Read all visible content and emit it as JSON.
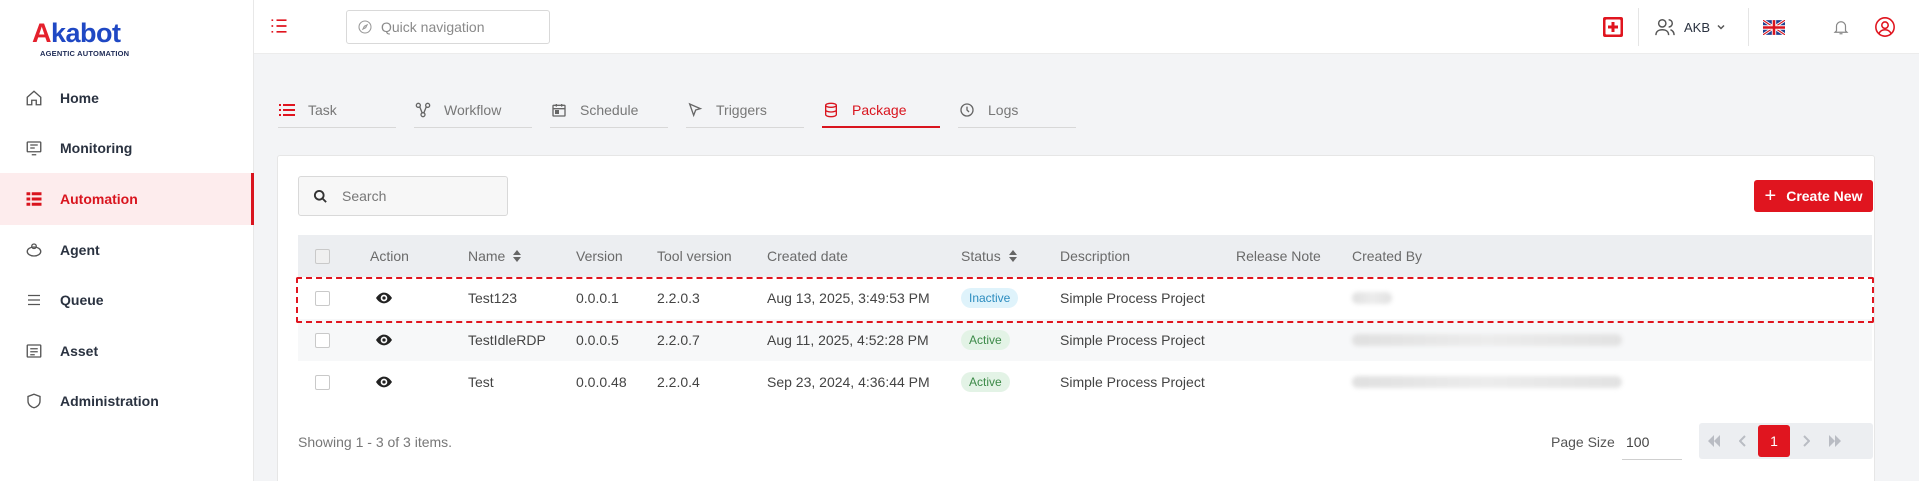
{
  "brand": {
    "name_part1": "A",
    "name_part2": "kabot",
    "tagline": "AGENTIC AUTOMATION"
  },
  "sidebar": {
    "items": [
      {
        "label": "Home",
        "icon": "home-icon"
      },
      {
        "label": "Monitoring",
        "icon": "monitor-icon"
      },
      {
        "label": "Automation",
        "icon": "automation-icon",
        "active": true
      },
      {
        "label": "Agent",
        "icon": "agent-icon"
      },
      {
        "label": "Queue",
        "icon": "queue-icon"
      },
      {
        "label": "Asset",
        "icon": "asset-icon"
      },
      {
        "label": "Administration",
        "icon": "shield-icon"
      }
    ]
  },
  "topbar": {
    "quick_nav_placeholder": "Quick navigation",
    "user_label": "AKB"
  },
  "tabs": [
    {
      "label": "Task",
      "icon": "list-icon"
    },
    {
      "label": "Workflow",
      "icon": "workflow-icon"
    },
    {
      "label": "Schedule",
      "icon": "calendar-icon"
    },
    {
      "label": "Triggers",
      "icon": "cursor-icon"
    },
    {
      "label": "Package",
      "icon": "database-icon",
      "active": true
    },
    {
      "label": "Logs",
      "icon": "clock-icon"
    }
  ],
  "search": {
    "placeholder": "Search"
  },
  "create_button": {
    "label": "Create New"
  },
  "table": {
    "columns": [
      "Action",
      "Name",
      "Version",
      "Tool version",
      "Created date",
      "Status",
      "Description",
      "Release Note",
      "Created By"
    ],
    "rows": [
      {
        "name": "Test123",
        "version": "0.0.0.1",
        "tool_version": "2.2.0.3",
        "created_date": "Aug 13, 2025, 3:49:53 PM",
        "status": "Inactive",
        "description": "Simple Process Project",
        "release_note": "",
        "created_by": ""
      },
      {
        "name": "TestIdleRDP",
        "version": "0.0.0.5",
        "tool_version": "2.2.0.7",
        "created_date": "Aug 11, 2025, 4:52:28 PM",
        "status": "Active",
        "description": "Simple Process Project",
        "release_note": "",
        "created_by": ""
      },
      {
        "name": "Test",
        "version": "0.0.0.48",
        "tool_version": "2.2.0.4",
        "created_date": "Sep 23, 2024, 4:36:44 PM",
        "status": "Active",
        "description": "Simple Process Project",
        "release_note": "",
        "created_by": ""
      }
    ]
  },
  "footer": {
    "summary": "Showing 1 - 3 of 3 items.",
    "page_size_label": "Page Size",
    "page_size_value": "100",
    "current_page": "1"
  },
  "colors": {
    "accent": "#e0151f",
    "brand_blue": "#1f48c4"
  }
}
